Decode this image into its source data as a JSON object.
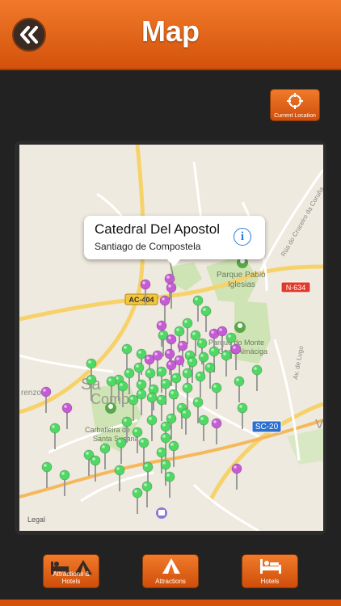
{
  "header": {
    "title": "Map",
    "back_icon": "double-chevron-left-icon"
  },
  "current_location": {
    "label": "Current Location",
    "icon": "crosshair-icon"
  },
  "callout": {
    "title": "Catedral Del Apostol",
    "subtitle": "Santiago de Compostela",
    "info_icon": "info-icon",
    "info_glyph": "i"
  },
  "map_labels": {
    "road_ac404": "AC-404",
    "road_n634": "N-634",
    "road_sc20": "SC-20",
    "parque_pablo": "Parque Pablo",
    "iglesias": "Iglesias",
    "parque_monte_1": "Parque do Monte",
    "parque_monte_2": "Gozo/Almáciga",
    "rua_cruceiro": "Rúa do Cruceiro da Coruña",
    "av_lugo": "Av. de Lugo",
    "santa_susana_1": "Carballeira de",
    "santa_susana_2": "Santa Susana",
    "lorenzo": "renzo",
    "santiago_1": "Sa",
    "santiago_2": "Comp",
    "v_edge": "V",
    "legal": "Legal"
  },
  "tabs": [
    {
      "label": "Attractions & Hotels",
      "icon": "bed-and-tent-icon"
    },
    {
      "label": "Attractions",
      "icon": "tent-icon"
    },
    {
      "label": "Hotels",
      "icon": "bed-icon"
    }
  ],
  "colors": {
    "accent": "#e8691c",
    "pin_green": "#4fd964",
    "pin_purple": "#c65bd6",
    "map_bg": "#efeadf"
  }
}
